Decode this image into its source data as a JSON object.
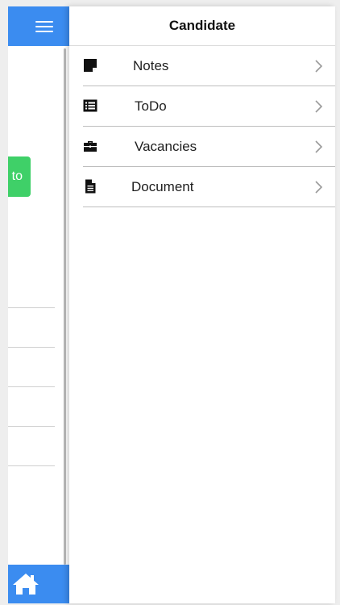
{
  "colors": {
    "header_blue": "#3b8cf0",
    "button_green": "#3fd068",
    "panel_bg": "#ffffff",
    "text": "#202020"
  },
  "background_page": {
    "menu_icon": "hamburger-menu-icon",
    "green_button_label": "to",
    "home_icon": "home-icon"
  },
  "panel": {
    "title": "Candidate",
    "items": [
      {
        "label": "Notes",
        "icon": "sticky-note-icon"
      },
      {
        "label": "ToDo",
        "icon": "list-icon"
      },
      {
        "label": "Vacancies",
        "icon": "briefcase-icon"
      },
      {
        "label": "Document",
        "icon": "document-icon"
      }
    ]
  }
}
